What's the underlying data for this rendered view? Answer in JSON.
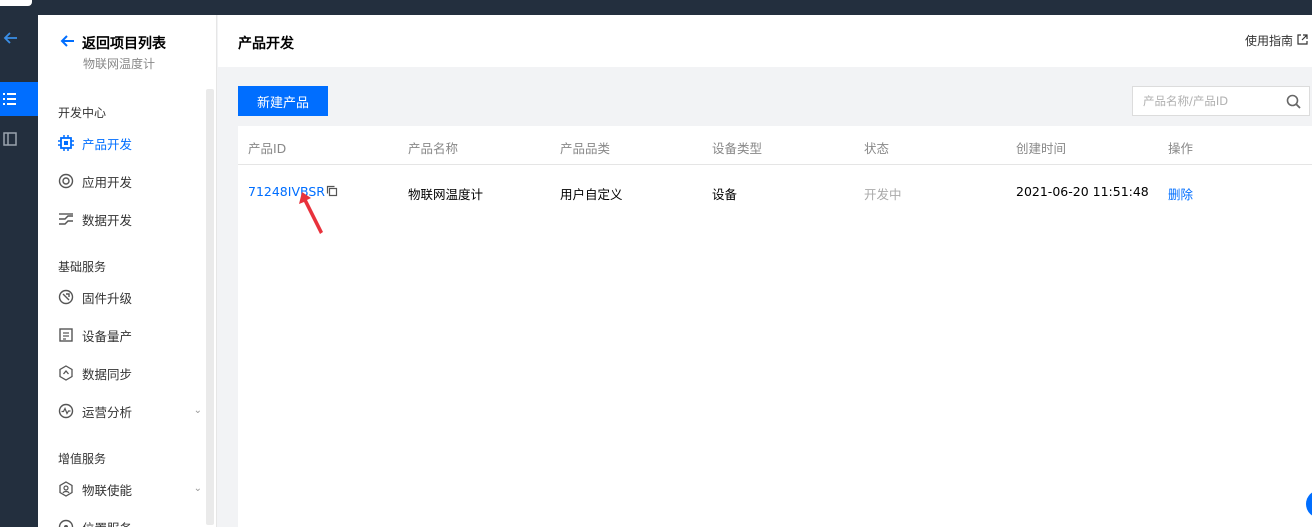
{
  "sidebar": {
    "back_label": "返回项目列表",
    "project_name": "物联网温度计",
    "groups": [
      {
        "title": "开发中心",
        "items": [
          {
            "label": "产品开发",
            "icon": "chip-icon",
            "active": true
          },
          {
            "label": "应用开发",
            "icon": "app-icon"
          },
          {
            "label": "数据开发",
            "icon": "data-flow-icon"
          }
        ]
      },
      {
        "title": "基础服务",
        "items": [
          {
            "label": "固件升级",
            "icon": "firmware-icon"
          },
          {
            "label": "设备量产",
            "icon": "device-batch-icon"
          },
          {
            "label": "数据同步",
            "icon": "sync-icon"
          },
          {
            "label": "运营分析",
            "icon": "analytics-icon",
            "expandable": true
          }
        ]
      },
      {
        "title": "增值服务",
        "items": [
          {
            "label": "物联使能",
            "icon": "enable-icon",
            "expandable": true
          },
          {
            "label": "位置服务",
            "icon": "location-icon"
          }
        ]
      }
    ]
  },
  "header": {
    "title": "产品开发",
    "guide_label": "使用指南"
  },
  "toolbar": {
    "new_product_label": "新建产品"
  },
  "search": {
    "placeholder": "产品名称/产品ID"
  },
  "table": {
    "columns": [
      "产品ID",
      "产品名称",
      "产品品类",
      "设备类型",
      "状态",
      "创建时间",
      "操作"
    ],
    "rows": [
      {
        "product_id": "71248IVBSR",
        "product_name": "物联网温度计",
        "category": "用户自定义",
        "device_type": "设备",
        "status": "开发中",
        "created_at": "2021-06-20 11:51:48",
        "action": "删除"
      }
    ]
  },
  "colors": {
    "accent": "#006eff",
    "rail_bg": "#232f3e",
    "annotation_arrow": "#e8323c"
  }
}
